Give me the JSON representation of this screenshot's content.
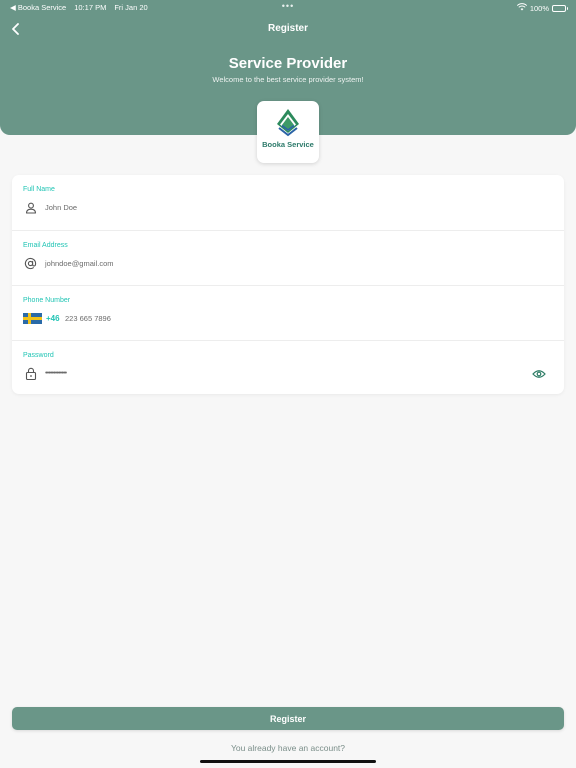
{
  "status_bar": {
    "back_app": "◀ Booka Service",
    "time": "10:17 PM",
    "date": "Fri Jan 20",
    "multitask": "•••",
    "battery": "100%"
  },
  "nav": {
    "title": "Register"
  },
  "hero": {
    "title": "Service Provider",
    "subtitle": "Welcome to the best service provider system!"
  },
  "logo": {
    "text": "Booka Service"
  },
  "form": {
    "full_name": {
      "label": "Full Name",
      "value": "John Doe",
      "icon": "person-icon"
    },
    "email": {
      "label": "Email Address",
      "value": "johndoe@gmail.com",
      "icon": "at-icon"
    },
    "phone": {
      "label": "Phone Number",
      "dial_code": "+46",
      "value": "223 665 7896",
      "flag": "sweden-flag"
    },
    "password": {
      "label": "Password",
      "value": "•••••••••••••",
      "icon": "lock-icon"
    }
  },
  "actions": {
    "register": "Register",
    "login_prompt": "You already have an account?"
  },
  "colors": {
    "primary": "#6a9688",
    "accent": "#20c4b4",
    "background": "#f7f7f7"
  }
}
